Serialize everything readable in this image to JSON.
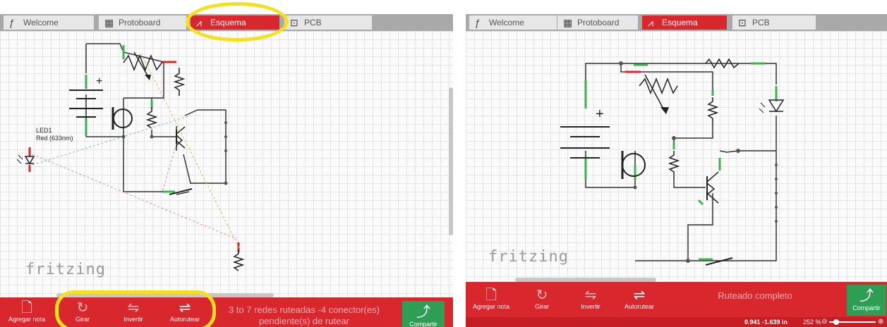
{
  "tabs": [
    {
      "label": "Welcome",
      "icon": "fritzing-f-icon"
    },
    {
      "label": "Protoboard",
      "icon": "breadboard-icon"
    },
    {
      "label": "Esquema",
      "icon": "schematic-icon"
    },
    {
      "label": "PCB",
      "icon": "pcb-icon"
    }
  ],
  "brand": "fritzing",
  "left_part": {
    "label": "LED1",
    "sublabel": "Red (633nm)"
  },
  "toolbar": {
    "add_note": "Agregar nota",
    "rotate": "Girar",
    "flip": "Invertir",
    "autoroute": "Autorutear",
    "share": "Compartir"
  },
  "status_left": "3 to 7 redes ruteadas -4 conector(es) pendiente(s) de rutear",
  "status_right": "Ruteado completo",
  "coords": "0.941 -1.639 in",
  "zoom": "252 %",
  "colors": {
    "accent": "#d9272e",
    "share": "#2e9e55",
    "highlight": "#f5e11a"
  }
}
